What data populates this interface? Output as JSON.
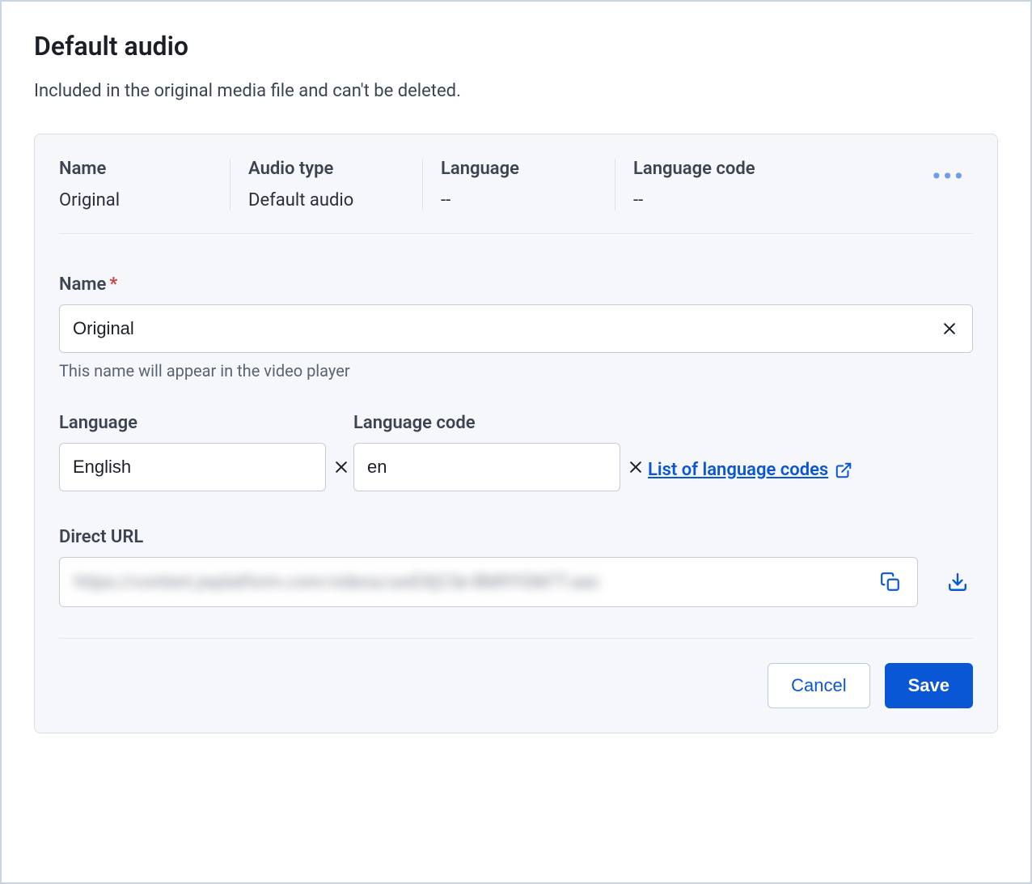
{
  "page": {
    "title": "Default audio",
    "subtitle": "Included in the original media file and can't be deleted."
  },
  "summary": {
    "columns": {
      "name": "Name",
      "audio_type": "Audio type",
      "language": "Language",
      "language_code": "Language code"
    },
    "values": {
      "name": "Original",
      "audio_type": "Default audio",
      "language": "--",
      "language_code": "--"
    }
  },
  "form": {
    "name": {
      "label": "Name",
      "value": "Original",
      "help": "This name will appear in the video player"
    },
    "language": {
      "label": "Language",
      "value": "English"
    },
    "language_code": {
      "label": "Language code",
      "value": "en"
    },
    "codes_link": "List of language codes",
    "direct_url": {
      "label": "Direct URL",
      "value": "https://content.jwplatform.com/videos/uwEXjC3e-BM9YGM7T.aac"
    }
  },
  "actions": {
    "cancel": "Cancel",
    "save": "Save"
  }
}
